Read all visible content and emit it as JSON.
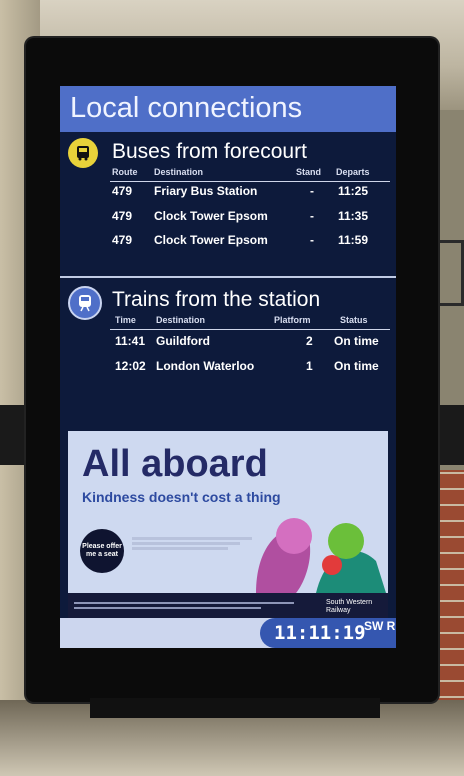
{
  "screen": {
    "title": "Local connections",
    "clock": "11:11:19",
    "brand_short": "SW R"
  },
  "buses": {
    "heading": "Buses from forecourt",
    "icon": "bus-icon",
    "columns": {
      "route": "Route",
      "destination": "Destination",
      "stand": "Stand",
      "departs": "Departs"
    },
    "rows": [
      {
        "route": "479",
        "destination": "Friary Bus Station",
        "stand": "-",
        "departs": "11:25"
      },
      {
        "route": "479",
        "destination": "Clock Tower Epsom",
        "stand": "-",
        "departs": "11:35"
      },
      {
        "route": "479",
        "destination": "Clock Tower Epsom",
        "stand": "-",
        "departs": "11:59"
      }
    ]
  },
  "trains": {
    "heading": "Trains from the station",
    "icon": "train-icon",
    "columns": {
      "time": "Time",
      "destination": "Destination",
      "platform": "Platform",
      "status": "Status"
    },
    "rows": [
      {
        "time": "11:41",
        "destination": "Guildford",
        "platform": "2",
        "status": "On time"
      },
      {
        "time": "12:02",
        "destination": "London Waterloo",
        "platform": "1",
        "status": "On time"
      }
    ]
  },
  "ad": {
    "headline": "All aboard",
    "subline": "Kindness doesn't cost a thing",
    "badge": "Please offer me a seat",
    "brand": "South Western Railway"
  },
  "colors": {
    "screen_bg": "#0d1a3b",
    "header_bg": "#4f6fc8",
    "bus_icon_bg": "#e8d23a",
    "train_icon_bg": "#4f6fc8",
    "ad_bg": "#ced9f0"
  }
}
